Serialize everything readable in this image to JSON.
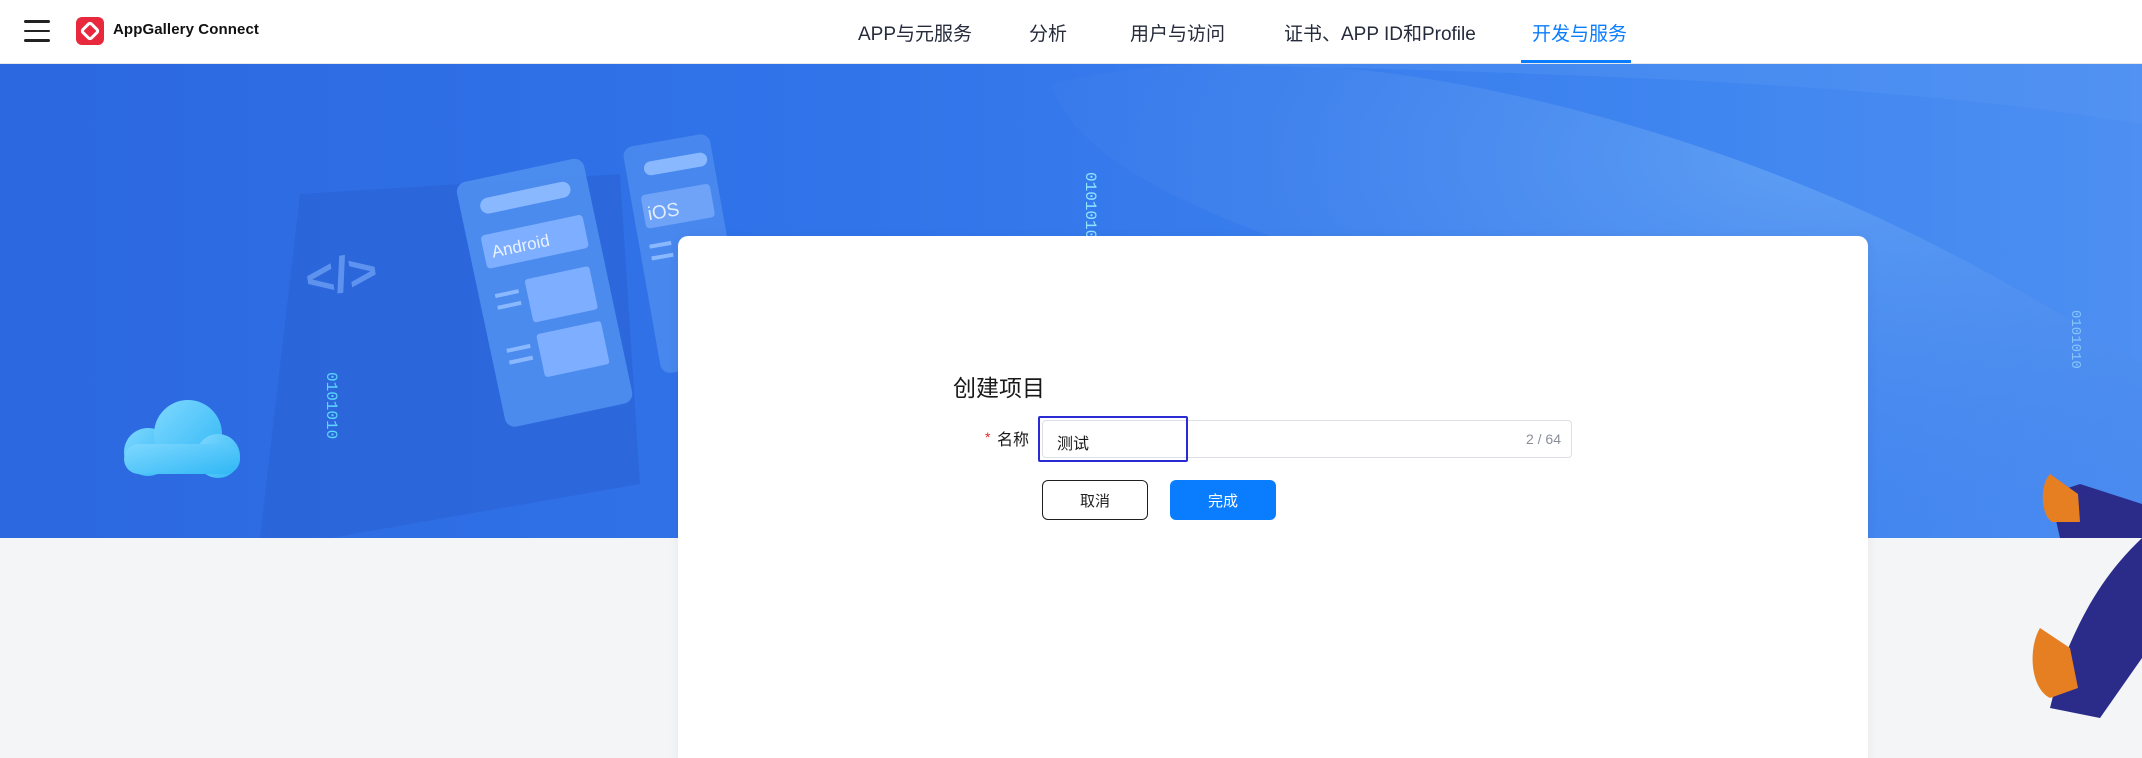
{
  "header": {
    "brand": "AppGallery Connect",
    "nav": [
      {
        "label": "APP与元服务",
        "active": false
      },
      {
        "label": "分析",
        "active": false
      },
      {
        "label": "用户与访问",
        "active": false
      },
      {
        "label": "证书、APP ID和Profile",
        "active": false
      },
      {
        "label": "开发与服务",
        "active": true
      }
    ],
    "accent_color": "#0a7dff",
    "logo_color": "#e8283c"
  },
  "hero": {
    "card_labels": {
      "android": "Android",
      "ios": "iOS"
    },
    "code_symbol": "</>",
    "binary_text": "0101010"
  },
  "dialog": {
    "title": "创建项目",
    "required_mark": "*",
    "name_label": "名称",
    "name_value": "测试",
    "char_count": "2 / 64",
    "cancel_label": "取消",
    "done_label": "完成"
  }
}
